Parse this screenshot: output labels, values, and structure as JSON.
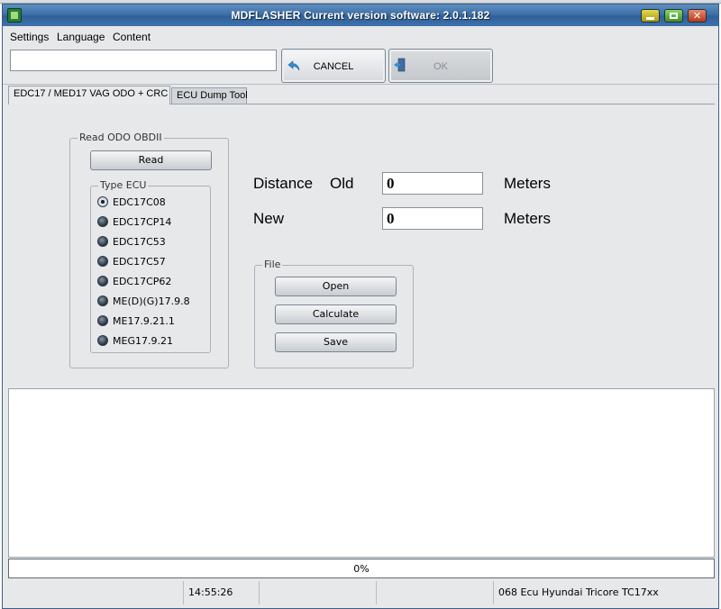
{
  "window": {
    "title": "MDFLASHER  Current version software: 2.0.1.182"
  },
  "menu": {
    "items": [
      "Settings",
      "Language",
      "Content"
    ]
  },
  "toolbar": {
    "input_value": "",
    "cancel_label": "CANCEL",
    "ok_label": "OK"
  },
  "tabs": [
    {
      "label": "EDC17 / MED17  VAG  ODO  +  CRC",
      "active": true
    },
    {
      "label": "ECU Dump Tool",
      "active": false
    }
  ],
  "read_group": {
    "title": "Read ODO OBDII",
    "read_button": "Read",
    "type_ecu_title": "Type ECU",
    "ecu_options": [
      "EDC17C08",
      "EDC17CP14",
      "EDC17C53",
      "EDC17C57",
      "EDC17CP62",
      "ME(D)(G)17.9.8",
      "ME17.9.21.1",
      "MEG17.9.21"
    ],
    "selected_index": 0
  },
  "distance": {
    "label": "Distance",
    "old_label": "Old",
    "old_value": "0",
    "new_label": "New",
    "new_value": "0",
    "unit": "Meters"
  },
  "file_group": {
    "title": "File",
    "open": "Open",
    "calculate": "Calculate",
    "save": "Save"
  },
  "progress": {
    "value": 0,
    "text": "0%"
  },
  "status": {
    "time": "14:55:26",
    "ecu_info": "068 Ecu Hyundai Tricore TC17xx"
  }
}
